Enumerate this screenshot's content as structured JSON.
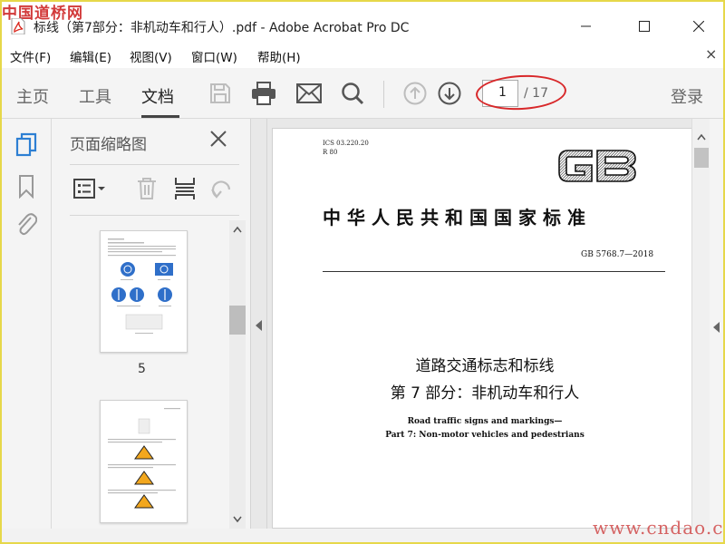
{
  "watermark": {
    "top": "中国道桥网",
    "bottom": "www.cndao.com"
  },
  "window": {
    "title": "标线（第7部分：非机动车和行人）.pdf - Adobe Acrobat Pro DC",
    "min_icon": "minimize-icon",
    "max_icon": "maximize-icon",
    "close_icon": "close-icon"
  },
  "menu": {
    "items": [
      "文件(F)",
      "编辑(E)",
      "视图(V)",
      "窗口(W)",
      "帮助(H)"
    ],
    "close_glyph": "×"
  },
  "toolbar": {
    "tabs": [
      "主页",
      "工具",
      "文档"
    ],
    "active_tab": "文档",
    "page_current": "1",
    "page_total": "/ 17",
    "login": "登录",
    "icons": [
      "save-icon",
      "print-icon",
      "email-icon",
      "search-icon",
      "page-up-icon",
      "page-down-icon"
    ],
    "annotation_color": "#d8282a"
  },
  "rail": {
    "icons": [
      "page-thumbnails-icon",
      "bookmark-icon",
      "attachment-icon"
    ],
    "accent": "#2d7fd3"
  },
  "thumbnails": {
    "title": "页面缩略图",
    "page_label": "5",
    "tools": [
      "options-icon",
      "delete-icon",
      "insert-page-icon",
      "rotate-icon"
    ]
  },
  "document": {
    "ics_line1": "ICS 03.220.20",
    "ics_line2": "R 80",
    "logo": "GB",
    "standard_cn": "中华人民共和国国家标准",
    "standard_no": "GB 5768.7—2018",
    "title_cn_1": "道路交通标志和标线",
    "title_cn_2": "第 7 部分：非机动车和行人",
    "title_en_1": "Road traffic signs and markings—",
    "title_en_2": "Part 7: Non-motor vehicles and pedestrians"
  }
}
